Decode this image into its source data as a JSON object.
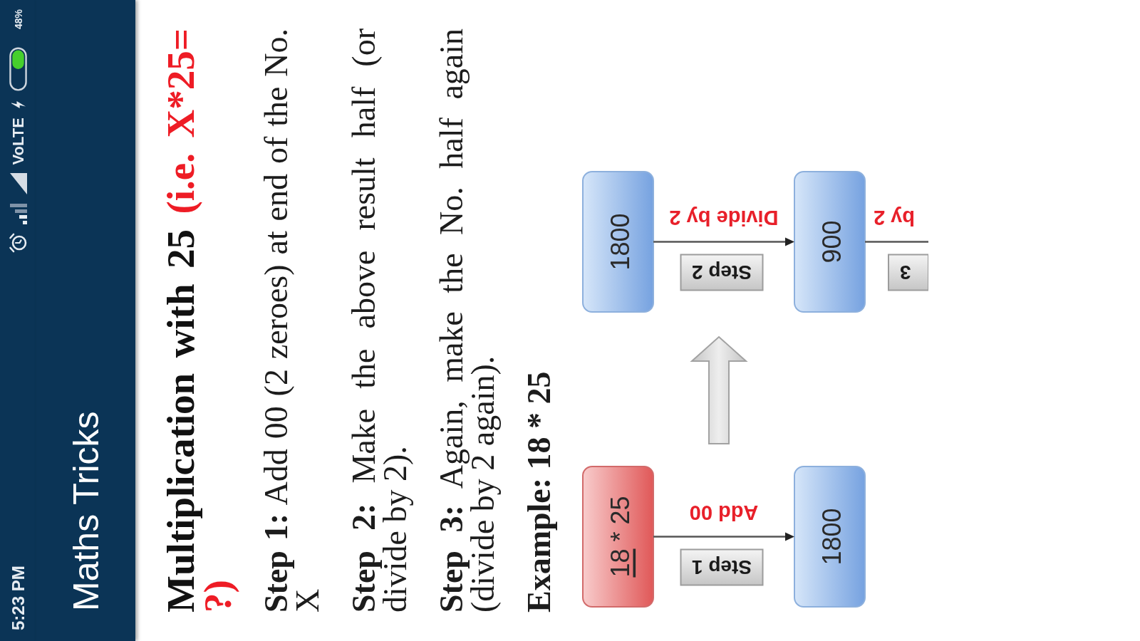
{
  "status_bar": {
    "time": "5:23 PM",
    "network": "VoLTE",
    "battery": "48%"
  },
  "app_bar": {
    "title": "Maths Tricks"
  },
  "heading": {
    "text": "Multiplication with 25",
    "note": "(i.e. X*25= ?)"
  },
  "steps": [
    "**Step 1:** Add 00 (2 zeroes) at end of the No. X",
    "**Step 2:** Make the above result half (or divide by 2).",
    "**Step 3:** Again, make the No. half again (divide by 2 again)."
  ],
  "example": "Example: 18 * 25",
  "diagram": {
    "columns": [
      {
        "nodes": [
          {
            "kind": "start",
            "parts": [
              {
                "text": "18",
                "underline": true
              },
              {
                "text": " * 25",
                "underline": false
              }
            ]
          },
          {
            "kind": "result",
            "parts": [
              {
                "text": "1800",
                "underline": false
              }
            ]
          }
        ],
        "edges": [
          {
            "label": "Add 00",
            "tag": "Step 1",
            "clipped": false
          }
        ]
      },
      {
        "nodes": [
          {
            "kind": "result",
            "parts": [
              {
                "text": "1800",
                "underline": false
              }
            ]
          },
          {
            "kind": "result",
            "parts": [
              {
                "text": "900",
                "underline": false
              }
            ]
          }
        ],
        "edges": [
          {
            "label": "Divide by 2",
            "tag": "Step 2",
            "clipped": false
          },
          {
            "label": "by 2",
            "tag": "3",
            "clipped": true
          }
        ]
      }
    ]
  }
}
